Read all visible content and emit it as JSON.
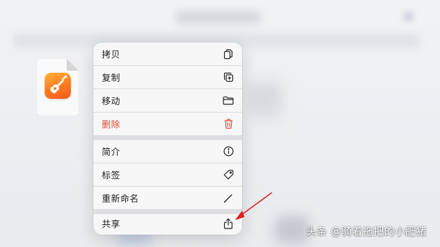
{
  "menu": {
    "items": [
      {
        "label": "拷贝",
        "icon": "copy-doc-icon"
      },
      {
        "label": "复制",
        "icon": "duplicate-icon"
      },
      {
        "label": "移动",
        "icon": "folder-icon"
      },
      {
        "label": "删除",
        "icon": "trash-icon",
        "color": "#e5453a"
      },
      {
        "label": "简介",
        "icon": "info-icon"
      },
      {
        "label": "标签",
        "icon": "tag-icon"
      },
      {
        "label": "重新命名",
        "icon": "pencil-icon"
      },
      {
        "label": "共享",
        "icon": "share-icon"
      }
    ]
  },
  "file": {
    "icon": "garageband-icon"
  },
  "annotation": {
    "color": "#e02020"
  },
  "watermark": "头条 @骑着拖把的小肥猪"
}
